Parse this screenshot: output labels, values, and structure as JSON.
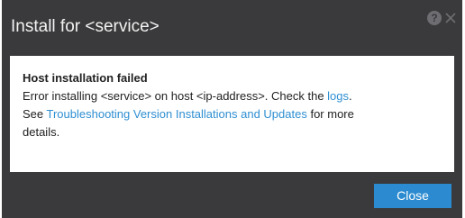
{
  "dialog": {
    "title": "Install for <service>",
    "icons": [
      "help-icon",
      "close-icon"
    ],
    "help_glyph": "?",
    "message": {
      "heading": "Host installation failed",
      "line1_prefix": "Error installing <service>  on host <ip-address>.  Check the ",
      "line1_link": "logs",
      "line1_suffix": ".",
      "line2_prefix": "See ",
      "line2_link": "Troubleshooting Version Installations and Updates",
      "line2_suffix": " for more",
      "line3": "details."
    },
    "close_label": "Close"
  },
  "colors": {
    "dialog_background": "#3a3a3c",
    "content_background": "#ffffff",
    "link": "#2f8fd2",
    "primary_button": "#2c8bd0"
  }
}
